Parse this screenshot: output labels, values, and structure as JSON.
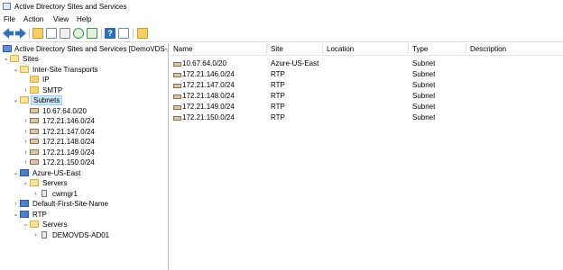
{
  "window": {
    "title": "Active Directory Sites and Services",
    "icon": "console-icon"
  },
  "menu": [
    {
      "label": "File"
    },
    {
      "label": "Action"
    },
    {
      "label": "View"
    },
    {
      "label": "Help"
    }
  ],
  "toolbar": {
    "buttons": [
      {
        "name": "back-icon",
        "color": "#2f6fba"
      },
      {
        "name": "forward-icon",
        "color": "#2f6fba"
      },
      {
        "name": "up-folder-icon",
        "color": "#d8ae3c"
      },
      {
        "name": "show-hide-tree-icon",
        "color": "#7a9cc6"
      },
      {
        "name": "properties-icon",
        "color": "#9a9a9a"
      },
      {
        "name": "refresh-icon",
        "color": "#3a9a4a"
      },
      {
        "name": "export-list-icon",
        "color": "#3a9a4a"
      },
      {
        "name": "help-icon",
        "color": "#2f6fba"
      },
      {
        "name": "show-pane-icon",
        "color": "#7a9cc6"
      },
      {
        "name": "new-item-icon",
        "color": "#d8ae3c"
      }
    ]
  },
  "tree": {
    "root": "Active Directory Sites and Services [DemoVDS-AD0",
    "sites": "Sites",
    "inter_site_transports": "Inter-Site Transports",
    "ip": "IP",
    "smtp": "SMTP",
    "subnets": "Subnets",
    "subnet_items": [
      "10.67.64.0/20",
      "172.21.146.0/24",
      "172.21.147.0/24",
      "172.21.148.0/24",
      "172.21.149.0/24",
      "172.21.150.0/24"
    ],
    "azure_site": "Azure-US-East",
    "azure_servers": "Servers",
    "azure_server": "cwmgr1",
    "default_site": "Default-First-Site-Name",
    "rtp_site": "RTP",
    "rtp_servers": "Servers",
    "rtp_server": "DEMOVDS-AD01"
  },
  "list": {
    "columns": [
      "Name",
      "Site",
      "Location",
      "Type",
      "Description"
    ],
    "rows": [
      {
        "name": "10.67.64.0/20",
        "site": "Azure-US-East",
        "location": "",
        "type": "Subnet",
        "description": ""
      },
      {
        "name": "172.21.146.0/24",
        "site": "RTP",
        "location": "",
        "type": "Subnet",
        "description": ""
      },
      {
        "name": "172.21.147.0/24",
        "site": "RTP",
        "location": "",
        "type": "Subnet",
        "description": ""
      },
      {
        "name": "172.21.148.0/24",
        "site": "RTP",
        "location": "",
        "type": "Subnet",
        "description": ""
      },
      {
        "name": "172.21.149.0/24",
        "site": "RTP",
        "location": "",
        "type": "Subnet",
        "description": ""
      },
      {
        "name": "172.21.150.0/24",
        "site": "RTP",
        "location": "",
        "type": "Subnet",
        "description": ""
      }
    ]
  }
}
